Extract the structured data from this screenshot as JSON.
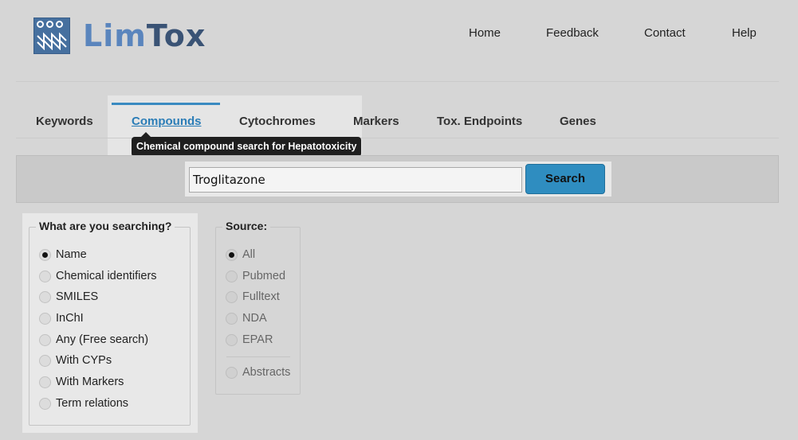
{
  "logo": {
    "lim": "Lim",
    "tox": "Tox"
  },
  "topnav": [
    {
      "label": "Home"
    },
    {
      "label": "Feedback"
    },
    {
      "label": "Contact"
    },
    {
      "label": "Help"
    }
  ],
  "tabs": [
    {
      "label": "Keywords"
    },
    {
      "label": "Compounds"
    },
    {
      "label": "Cytochromes"
    },
    {
      "label": "Markers"
    },
    {
      "label": "Tox. Endpoints"
    },
    {
      "label": "Genes"
    }
  ],
  "tooltip": "Chemical compound search for Hepatotoxicity",
  "search": {
    "value": "Troglitazone",
    "button": "Search"
  },
  "search_type": {
    "legend": "What are you searching?",
    "selected": "Name",
    "options": [
      "Name",
      "Chemical identifiers",
      "SMILES",
      "InChI",
      "Any (Free search)",
      "With CYPs",
      "With Markers",
      "Term relations"
    ]
  },
  "source": {
    "legend": "Source:",
    "selected": "All",
    "options": [
      "All",
      "Pubmed",
      "Fulltext",
      "NDA",
      "EPAR"
    ],
    "extra": "Abstracts"
  },
  "colors": {
    "accent": "#2f8dc0",
    "active_tab": "#2b7db7",
    "logo_light": "#5a85bd",
    "logo_dark": "#3a5375"
  }
}
